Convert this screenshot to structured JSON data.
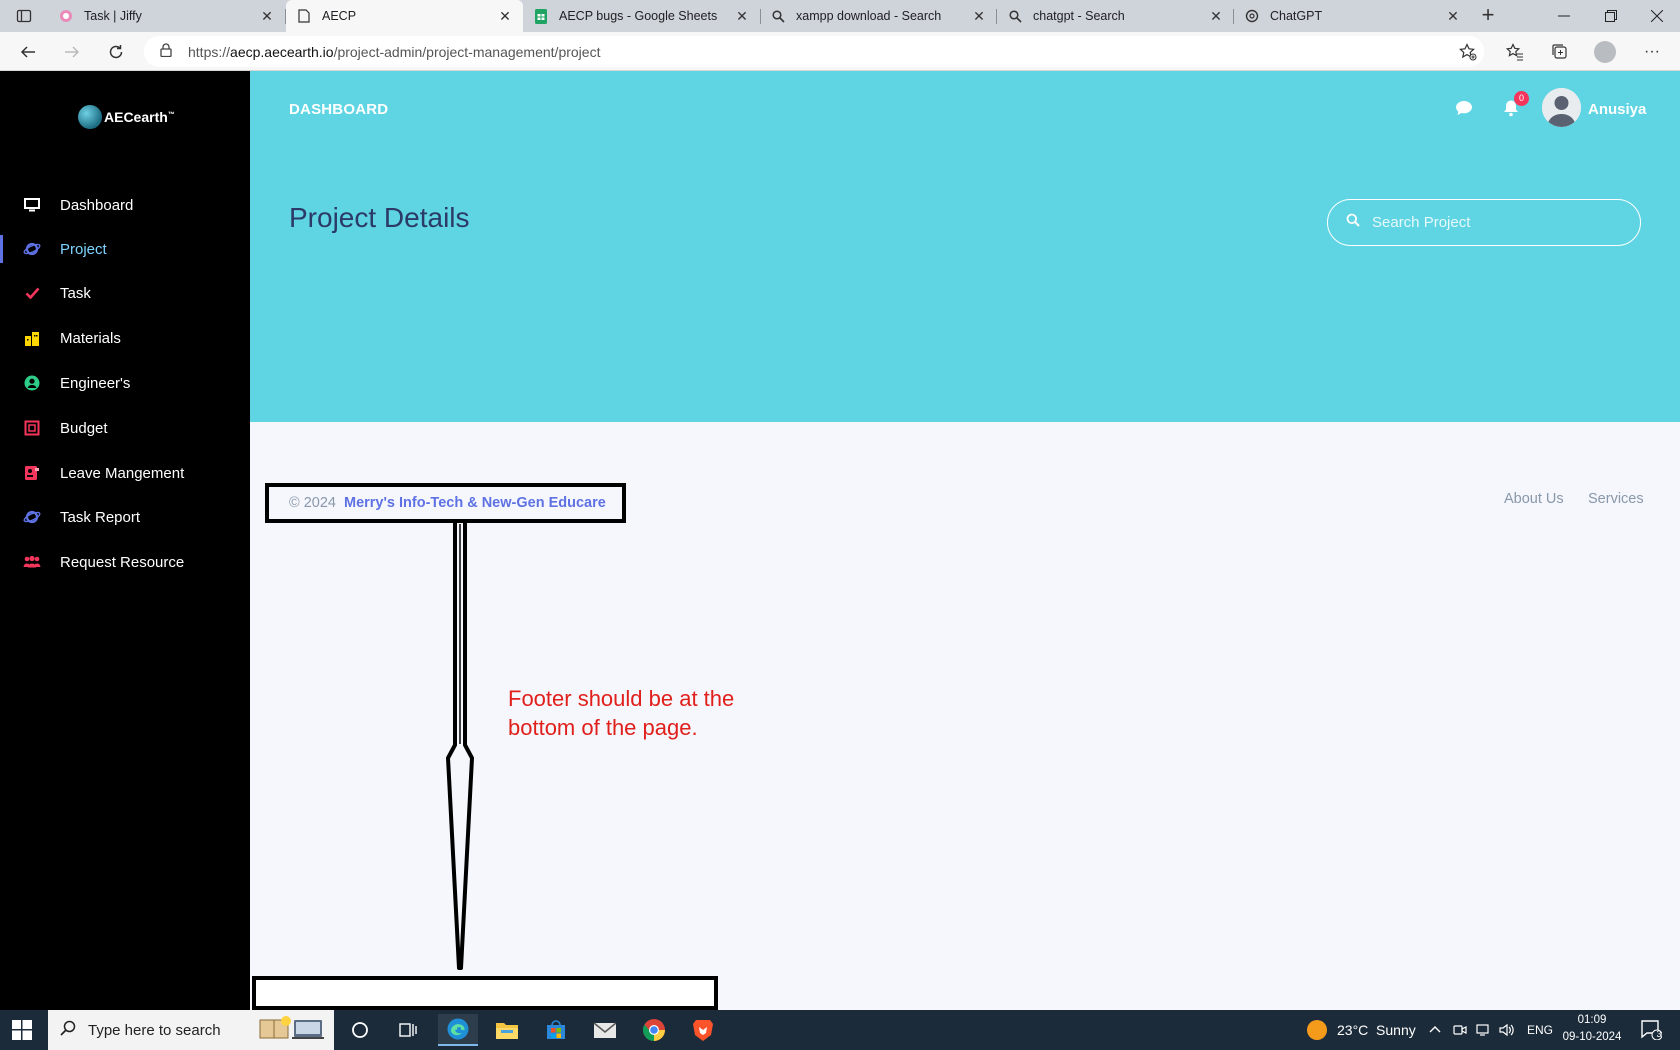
{
  "browser": {
    "tabs": [
      {
        "label": "Task | Jiffy",
        "icon": "jiffy-icon"
      },
      {
        "label": "AECP",
        "icon": "page-icon",
        "active": true
      },
      {
        "label": "AECP bugs - Google Sheets",
        "icon": "sheets-icon"
      },
      {
        "label": "xampp download - Search",
        "icon": "search-icon"
      },
      {
        "label": "chatgpt - Search",
        "icon": "search-icon"
      },
      {
        "label": "ChatGPT",
        "icon": "chatgpt-icon"
      }
    ],
    "url_prefix": "https://",
    "url_host": "aecp.aecearth.io",
    "url_path": "/project-admin/project-management/project"
  },
  "sidebar": {
    "logo_text": "AECearth",
    "logo_mark": "™",
    "items": [
      {
        "label": "Dashboard",
        "icon": "monitor-icon",
        "color": "#ffffff"
      },
      {
        "label": "Project",
        "icon": "planet-icon",
        "color": "#5e72e4",
        "active": true
      },
      {
        "label": "Task",
        "icon": "check-icon",
        "color": "#f5365c"
      },
      {
        "label": "Materials",
        "icon": "buildings-icon",
        "color": "#ffd600"
      },
      {
        "label": "Engineer's",
        "icon": "user-circle-icon",
        "color": "#2dce89"
      },
      {
        "label": "Budget",
        "icon": "budget-icon",
        "color": "#f5365c"
      },
      {
        "label": "Leave Mangement",
        "icon": "badge-icon",
        "color": "#f3a4b5"
      },
      {
        "label": "Task Report",
        "icon": "planet-icon",
        "color": "#5e72e4"
      },
      {
        "label": "Request Resource",
        "icon": "group-icon",
        "color": "#f5365c"
      }
    ]
  },
  "header": {
    "brand": "DASHBOARD",
    "notification_count": "0",
    "username": "Anusiya",
    "page_title": "Project Details",
    "search_placeholder": "Search Project",
    "background": "#5fd5e3"
  },
  "footer": {
    "copyright": "© 2024",
    "company": "Merry's Info-Tech & New-Gen Educare",
    "links": [
      "About Us",
      "Services"
    ]
  },
  "annotation": {
    "text": "Footer should be at the bottom of the page."
  },
  "taskbar": {
    "search_placeholder": "Type here to search",
    "weather": "23°C  Sunny",
    "language": "ENG",
    "time": "01:09",
    "date": "09-10-2024",
    "notification_count": "3"
  }
}
